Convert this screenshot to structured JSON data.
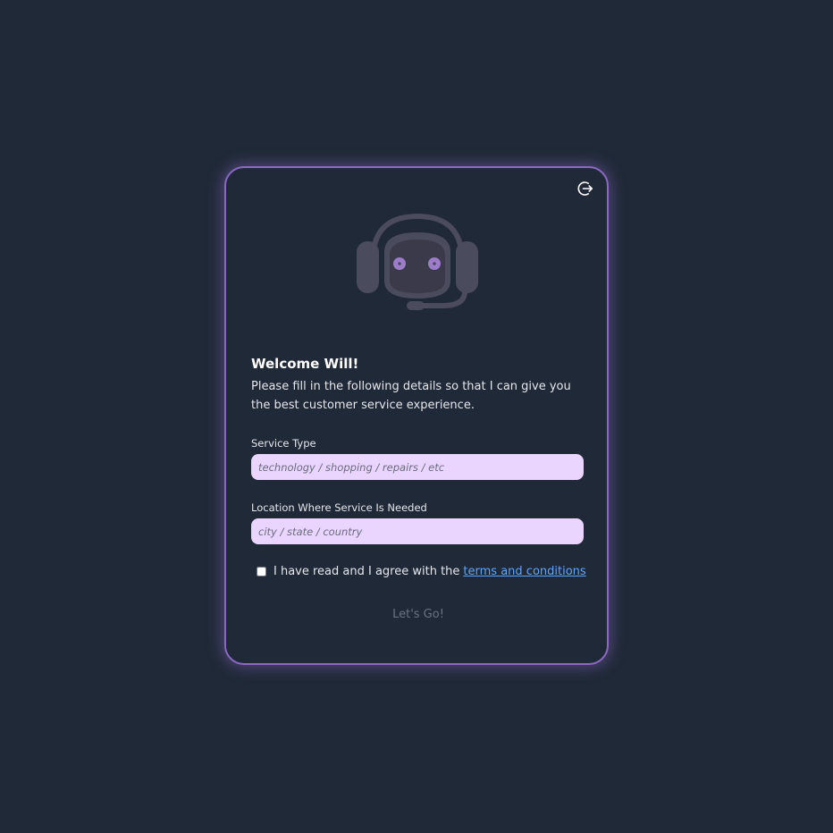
{
  "welcome": {
    "title": "Welcome Will!",
    "message": "Please fill in the following details so that I can give you the best customer service experience."
  },
  "form": {
    "service_type": {
      "label": "Service Type",
      "placeholder": "technology / shopping / repairs / etc",
      "value": ""
    },
    "location": {
      "label": "Location Where Service Is Needed",
      "placeholder": "city / state / country",
      "value": ""
    },
    "agreement": {
      "text": "I have read and I agree with the",
      "link_text": "terms and conditions",
      "checked": false
    },
    "submit_label": "Let's Go!"
  },
  "icons": {
    "logout": "logout-icon",
    "avatar": "support-bot-headset-icon"
  },
  "colors": {
    "background": "#1f2937",
    "card_border": "#8b68c4",
    "input_background": "#e9d5ff",
    "link": "#60a5fa",
    "avatar_gray": "#4b4b5e",
    "avatar_eye": "#9d7cc9"
  }
}
